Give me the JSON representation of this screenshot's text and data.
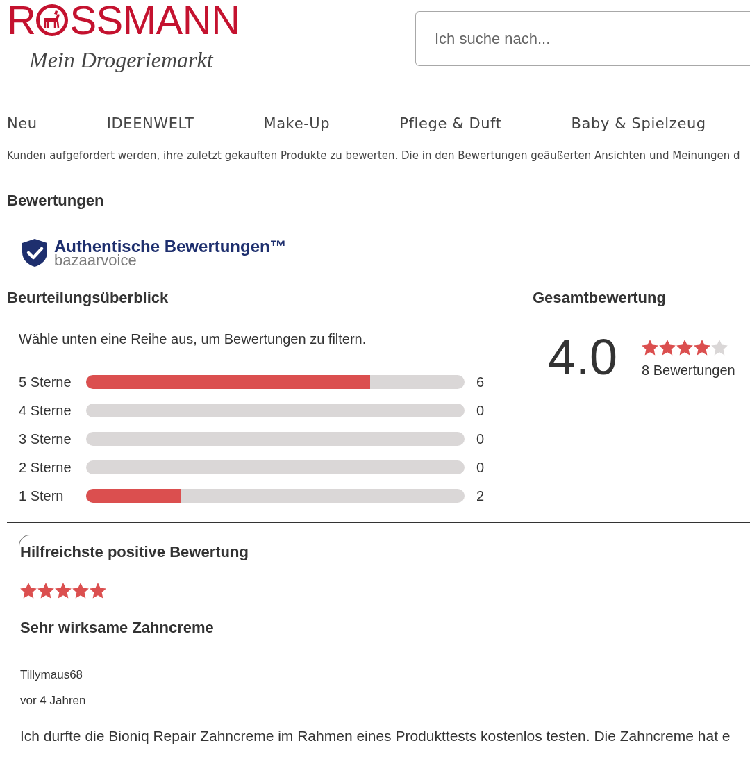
{
  "header": {
    "logo": {
      "wordmark_start": "R",
      "wordmark_end": "SSMANN",
      "tagline": "Mein Drogeriemarkt"
    },
    "search": {
      "placeholder": "Ich suche nach..."
    }
  },
  "nav": [
    "Neu",
    "IDEENWELT",
    "Make-Up",
    "Pflege & Duft",
    "Baby & Spielzeug"
  ],
  "notice": "Kunden aufgefordert werden, ihre zuletzt gekauften Produkte zu bewerten. Die in den Bewertungen geäußerten Ansichten und Meinungen d",
  "reviews": {
    "title": "Bewertungen",
    "badge": {
      "title": "Authentische Bewertungen™",
      "brand": "bazaarvoice"
    },
    "overview": {
      "title": "Beurteilungsüberblick",
      "hint": "Wähle unten eine Reihe aus, um Bewertungen zu filtern.",
      "rows": [
        {
          "label": "5 Sterne",
          "level": 0.75,
          "count": "6"
        },
        {
          "label": "4 Sterne",
          "level": 0,
          "count": "0"
        },
        {
          "label": "3 Sterne",
          "level": 0,
          "count": "0"
        },
        {
          "label": "2 Sterne",
          "level": 0,
          "count": "0"
        },
        {
          "label": "1 Stern",
          "level": 0.25,
          "count": "2"
        }
      ]
    },
    "overall": {
      "title": "Gesamtbewertung",
      "rating": "4.0",
      "stars": 4,
      "count": "8 Bewertungen"
    },
    "top_review": {
      "title": "Hilfreichste positive Bewertung",
      "stars": 5,
      "headline": "Sehr wirksame Zahncreme",
      "author": "Tillymaus68",
      "date": "vor 4 Jahren",
      "text": "Ich durfte die Bioniq Repair Zahncreme im Rahmen eines Produkttests kostenlos testen. Die Zahncreme hat e"
    }
  }
}
